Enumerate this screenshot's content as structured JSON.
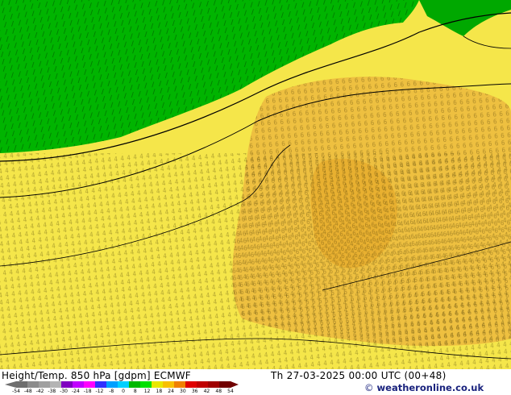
{
  "map": {
    "colors": {
      "green_bright": "#00b800",
      "green_dark": "#00a000",
      "yellow_light": "#f5ec5a",
      "yellow_warm": "#f0c83a",
      "orange_warm": "#e8a832",
      "contour_line": "#000000"
    },
    "field_digits": [
      "0",
      "1",
      "2",
      "3",
      "4",
      "5",
      "6",
      "7",
      "8"
    ]
  },
  "footer": {
    "title": "Height/Temp. 850 hPa [gdpm] ECMWF",
    "valid_time": "Th 27-03-2025 00:00 UTC (00+48)",
    "credit": "weatheronline.co.uk",
    "credit_symbol": "©"
  },
  "legend": {
    "ticks": [
      "-54",
      "-48",
      "-42",
      "-38",
      "-30",
      "-24",
      "-18",
      "-12",
      "-8",
      "0",
      "8",
      "12",
      "18",
      "24",
      "30",
      "36",
      "42",
      "48",
      "54"
    ],
    "colors": [
      "#6e6e6e",
      "#8c8c8c",
      "#a0a0a0",
      "#b4b4b4",
      "#8000c0",
      "#c000ff",
      "#ff00ff",
      "#3030ff",
      "#00a0ff",
      "#00d0ff",
      "#00b800",
      "#00e000",
      "#e8e800",
      "#f8c000",
      "#f08000",
      "#e00000",
      "#c00000",
      "#a00000",
      "#700000"
    ]
  }
}
